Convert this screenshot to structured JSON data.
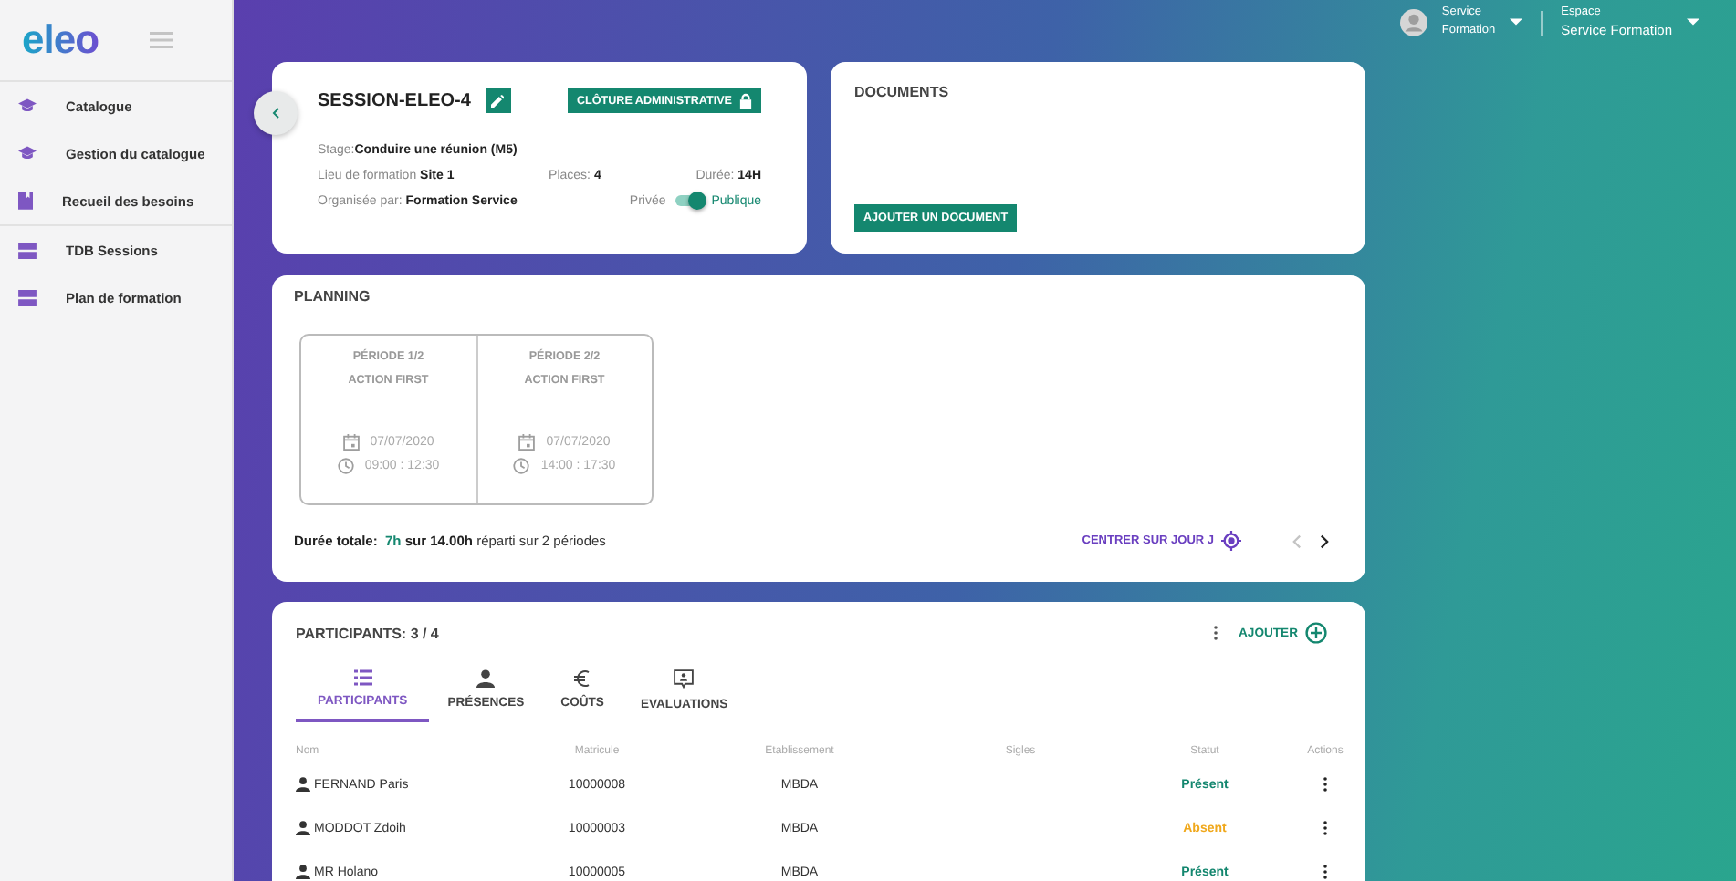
{
  "app": {
    "logo": "eleo"
  },
  "sidebar": {
    "items": [
      {
        "label": "Catalogue",
        "kind": "cap",
        "selected": false
      },
      {
        "label": "Gestion du catalogue",
        "kind": "cap",
        "selected": false
      },
      {
        "label": "Recueil des besoins",
        "kind": "book",
        "selected": false
      },
      {
        "label": "TDB Sessions",
        "kind": "stack",
        "selected": false
      },
      {
        "label": "Plan de formation",
        "kind": "stack",
        "selected": false
      }
    ]
  },
  "user_menu": {
    "name_line1": "Service",
    "name_line2": "Formation",
    "space_label": "Espace",
    "space_value": "Service Formation"
  },
  "session": {
    "title": "SESSION-ELEO-4",
    "closure_button": "CLÔTURE ADMINISTRATIVE",
    "stage_label": "Stage:",
    "stage_value": "Conduire une réunion (M5)",
    "place_label": "Lieu de formation",
    "place_value": "Site 1",
    "seats_label": "Places:",
    "seats_value": "4",
    "duration_label": "Durée:",
    "duration_value": "14H",
    "organizer_label": "Organisée par:",
    "organizer_value": "Formation Service",
    "visibility": {
      "off_label": "Privée",
      "on_label": "Publique",
      "on": true
    }
  },
  "documents": {
    "title": "DOCUMENTS",
    "add_button": "AJOUTER UN DOCUMENT"
  },
  "planning": {
    "title": "PLANNING",
    "periods": [
      {
        "period": "PÉRIODE 1/2",
        "action": "ACTION FIRST",
        "date": "07/07/2020",
        "time": "09:00 : 12:30"
      },
      {
        "period": "PÉRIODE 2/2",
        "action": "ACTION FIRST",
        "date": "07/07/2020",
        "time": "14:00 : 17:30"
      }
    ],
    "summary_label": "Durée totale:",
    "planned": "7h",
    "summary_rest": "**sur 14.00h** réparti sur 2 périodes",
    "center_button": "CENTRER SUR JOUR J"
  },
  "participants": {
    "title": "PARTICIPANTS: 3 / 4",
    "add_button": "AJOUTER",
    "tabs": [
      {
        "label": "PARTICIPANTS",
        "kind": "list",
        "selected": true
      },
      {
        "label": "PRÉSENCES",
        "kind": "person",
        "selected": false
      },
      {
        "label": "COÛTS",
        "kind": "euro",
        "selected": false
      },
      {
        "label": "EVALUATIONS",
        "kind": "feedback",
        "selected": false
      }
    ],
    "columns": [
      "Nom",
      "Matricule",
      "Etablissement",
      "Sigles",
      "Statut",
      "Actions"
    ],
    "rows": [
      {
        "name": "FERNAND Paris",
        "id": "10000008",
        "site": "MBDA",
        "status": "Présent",
        "color": "#14876f"
      },
      {
        "name": "MODDOT Zdoih",
        "id": "10000003",
        "site": "MBDA",
        "status": "Absent",
        "color": "#f0a81c"
      },
      {
        "name": "MR Holano",
        "id": "10000005",
        "site": "MBDA",
        "status": "Présent",
        "color": "#14876f"
      }
    ]
  }
}
